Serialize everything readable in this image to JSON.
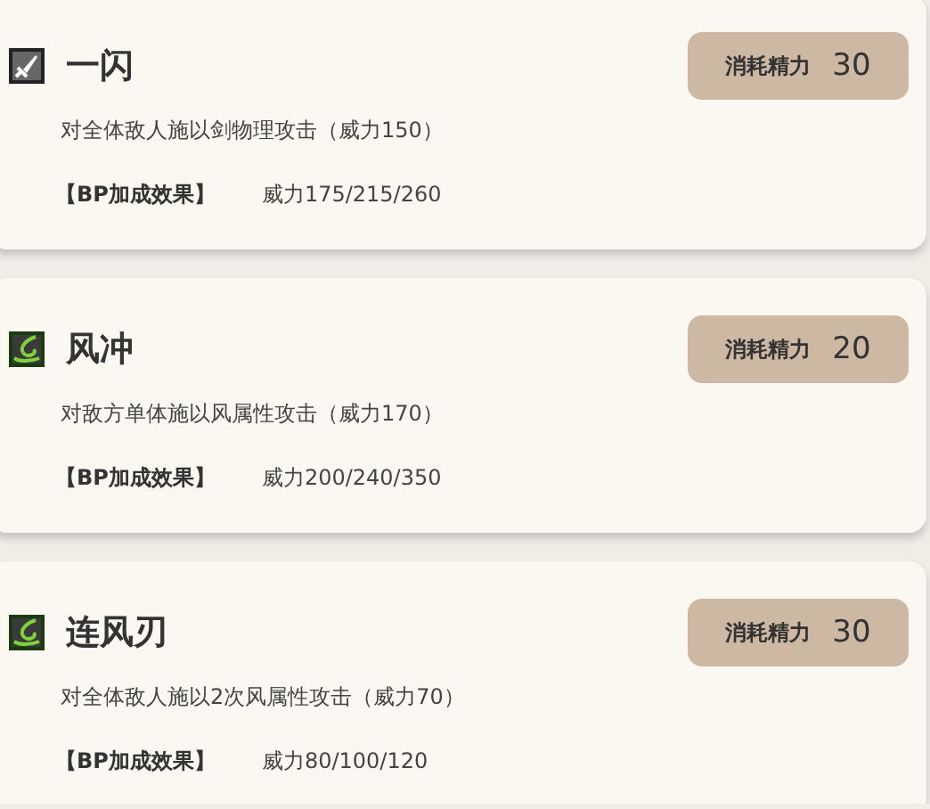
{
  "skills": [
    {
      "kind": "sword",
      "name": "一闪",
      "cost_label": "消耗精力",
      "cost": "30",
      "description": "对全体敌人施以剑物理攻击（威力150）",
      "bp_label": "【BP加成效果】",
      "bp_value": "威力175/215/260"
    },
    {
      "kind": "wind",
      "name": "风冲",
      "cost_label": "消耗精力",
      "cost": "20",
      "description": "对敌方单体施以风属性攻击（威力170）",
      "bp_label": "【BP加成效果】",
      "bp_value": "威力200/240/350"
    },
    {
      "kind": "wind",
      "name": "连风刃",
      "cost_label": "消耗精力",
      "cost": "30",
      "description": "对全体敌人施以2次风属性攻击（威力70）",
      "bp_label": "【BP加成效果】",
      "bp_value": "威力80/100/120"
    }
  ]
}
